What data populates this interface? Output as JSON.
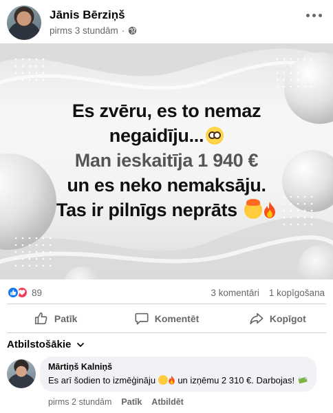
{
  "post": {
    "author": "Jānis Bērziņš",
    "time": "pirms 3 stundām",
    "separator": "·",
    "image_text": {
      "line1": "Es zvēru, es to nemaz",
      "line2": "negaidīju...",
      "line3": "Man ieskaitīja 1 940 €",
      "line4": "un es neko nemaksāju.",
      "line5": "Tas ir pilnīgs neprāts"
    }
  },
  "stats": {
    "reaction_count": "89",
    "comments": "3 komentāri",
    "shares": "1 kopīgošana"
  },
  "actions": {
    "like": "Patīk",
    "comment": "Komentēt",
    "share": "Kopīgot"
  },
  "comments_section": {
    "sort_label": "Atbilstošākie",
    "items": [
      {
        "author": "Mārtiņš Kalniņš",
        "text_part1": "Es arī šodien to izmēģināju ",
        "text_part2": " un izņēmu 2 310 €. Darbojas! ",
        "time": "pirms 2 stundām",
        "like": "Patīk",
        "reply": "Atbildēt"
      }
    ]
  },
  "colors": {
    "brand_blue": "#1877f2",
    "love_red": "#f33e58",
    "secondary_text": "#65676b",
    "bubble_bg": "#f0f2f5"
  }
}
